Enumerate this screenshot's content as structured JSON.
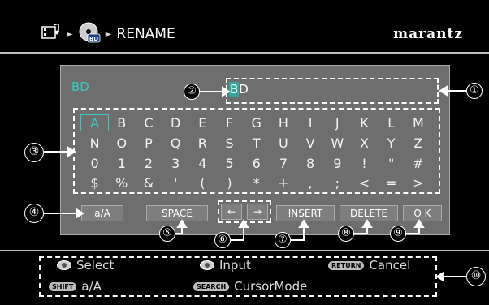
{
  "header": {
    "title": "RENAME",
    "brand": "marantz"
  },
  "name_panel": {
    "label": "BD",
    "value_first": "B",
    "value_rest": "D"
  },
  "keyboard": {
    "rows": [
      [
        "A",
        "B",
        "C",
        "D",
        "E",
        "F",
        "G",
        "H",
        "I",
        "J",
        "K",
        "L",
        "M"
      ],
      [
        "N",
        "O",
        "P",
        "Q",
        "R",
        "S",
        "T",
        "U",
        "V",
        "W",
        "X",
        "Y",
        "Z"
      ],
      [
        "0",
        "1",
        "2",
        "3",
        "4",
        "5",
        "6",
        "7",
        "8",
        "9",
        "!",
        "\"",
        "#"
      ],
      [
        "$",
        "%",
        "&",
        "'",
        "(",
        ")",
        "*",
        "+",
        ",",
        ";",
        "<",
        "=",
        ">"
      ]
    ],
    "selected_key": "A"
  },
  "buttons": {
    "case": "a/A",
    "space": "SPACE",
    "left": "←",
    "right": "→",
    "insert": "INSERT",
    "delete": "DELETE",
    "ok": "O K"
  },
  "callouts": [
    "①",
    "②",
    "③",
    "④",
    "⑤",
    "⑥",
    "⑦",
    "⑧",
    "⑨",
    "⑩"
  ],
  "footer": {
    "select": "Select",
    "input": "Input",
    "return_key": "RETURN",
    "cancel": "Cancel",
    "shift_key": "SHIFT",
    "shift_action": "a/A",
    "search_key": "SEARCH",
    "search_action": "CursorMode"
  }
}
